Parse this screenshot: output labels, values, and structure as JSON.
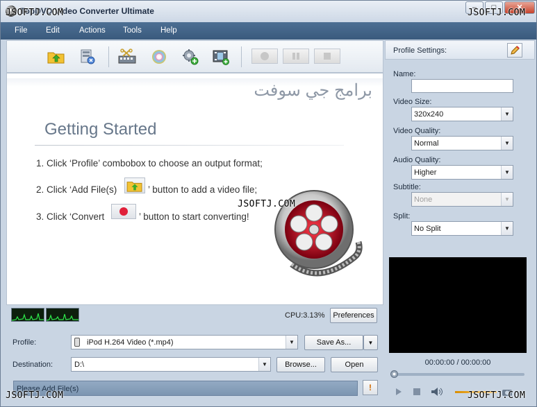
{
  "app": {
    "title": "TopDVD Video Converter Ultimate",
    "window_buttons": {
      "minimize": "–",
      "maximize": "□",
      "close": "✕"
    }
  },
  "watermark": "JSOFTJ.COM",
  "menu": [
    "File",
    "Edit",
    "Actions",
    "Tools",
    "Help"
  ],
  "toolbar": {
    "buttons": [
      "add-file-icon",
      "remove-file-icon",
      "clip-icon",
      "effect-icon",
      "settings-add-icon",
      "merge-icon"
    ],
    "controls": [
      "convert-record-icon",
      "pause-icon",
      "stop-icon"
    ]
  },
  "getting_started": {
    "arabic_banner": "برامج جي سوفت",
    "title": "Getting Started",
    "step1": "1. Click ‘Profile’ combobox to choose an output format;",
    "step2_before": "2. Click ‘Add File(s)",
    "step2_after": "’ button to add a video file;",
    "step3_before": "3. Click ‘Convert",
    "step3_after": "’ button to start converting!"
  },
  "status_bar": {
    "cpu": "CPU:3.13%",
    "preferences": "Preferences"
  },
  "output": {
    "profile_label": "Profile:",
    "profile_value": "iPod H.264 Video (*.mp4)",
    "save_as": "Save As...",
    "destination_label": "Destination:",
    "destination_value": "D:\\",
    "browse": "Browse...",
    "open": "Open"
  },
  "status_message": "Please Add File(s)",
  "profile_settings": {
    "title": "Profile Settings:",
    "name_label": "Name:",
    "name_value": "",
    "video_size_label": "Video Size:",
    "video_size_value": "320x240",
    "video_quality_label": "Video Quality:",
    "video_quality_value": "Normal",
    "audio_quality_label": "Audio Quality:",
    "audio_quality_value": "Higher",
    "subtitle_label": "Subtitle:",
    "subtitle_value": "None",
    "split_label": "Split:",
    "split_value": "No Split"
  },
  "player": {
    "time": "00:00:00 / 00:00:00"
  },
  "colors": {
    "menubar": "#3f6184",
    "panel": "#c9d5e3",
    "record": "#e0203a"
  }
}
